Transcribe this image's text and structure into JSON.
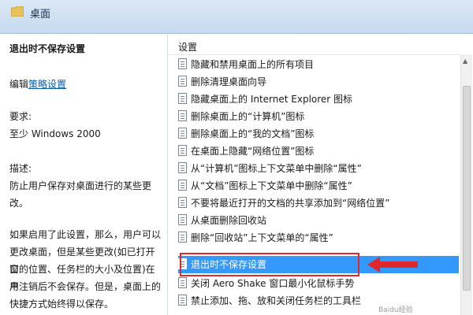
{
  "header": {
    "title": "桌面"
  },
  "left": {
    "title": "退出时不保存设置",
    "edit_prefix": "编辑",
    "edit_link": "策略设置",
    "requirements_label": "要求:",
    "requirements_value": "至少 Windows 2000",
    "description_label": "描述:",
    "description_lines": [
      "防止用户保存对桌面进行的某些更",
      "改。"
    ],
    "detail_lines": [
      "如果启用了此设置，那么，用户可以",
      "更改桌面，但是某些更改(如已打开窗",
      "口的位置、任务栏的大小及位置)在用",
      "户注销后不会保存。但是，桌面上的",
      "快捷方式始终得以保存。"
    ]
  },
  "right": {
    "column_header": "设置",
    "items": [
      "隐藏和禁用桌面上的所有项目",
      "删除清理桌面向导",
      "隐藏桌面上的 Internet Explorer 图标",
      "删除桌面上的“计算机”图标",
      "删除桌面上的“我的文档”图标",
      "在桌面上隐藏“网络位置”图标",
      "从“计算机”图标上下文菜单中删除“属性”",
      "从“文档”图标上下文菜单中删除“属性”",
      "不要将最近打开的文档的共享添加到“网络位置”",
      "从桌面删除回收站",
      "删除“回收站”上下文菜单的“属性”",
      "退出时不保存设置",
      "关闭 Aero Shake 窗口最小化鼠标手势",
      "禁止添加、拖、放和关闭任务栏的工具栏"
    ],
    "selected_index": 11
  },
  "watermark": "Baidu经验"
}
